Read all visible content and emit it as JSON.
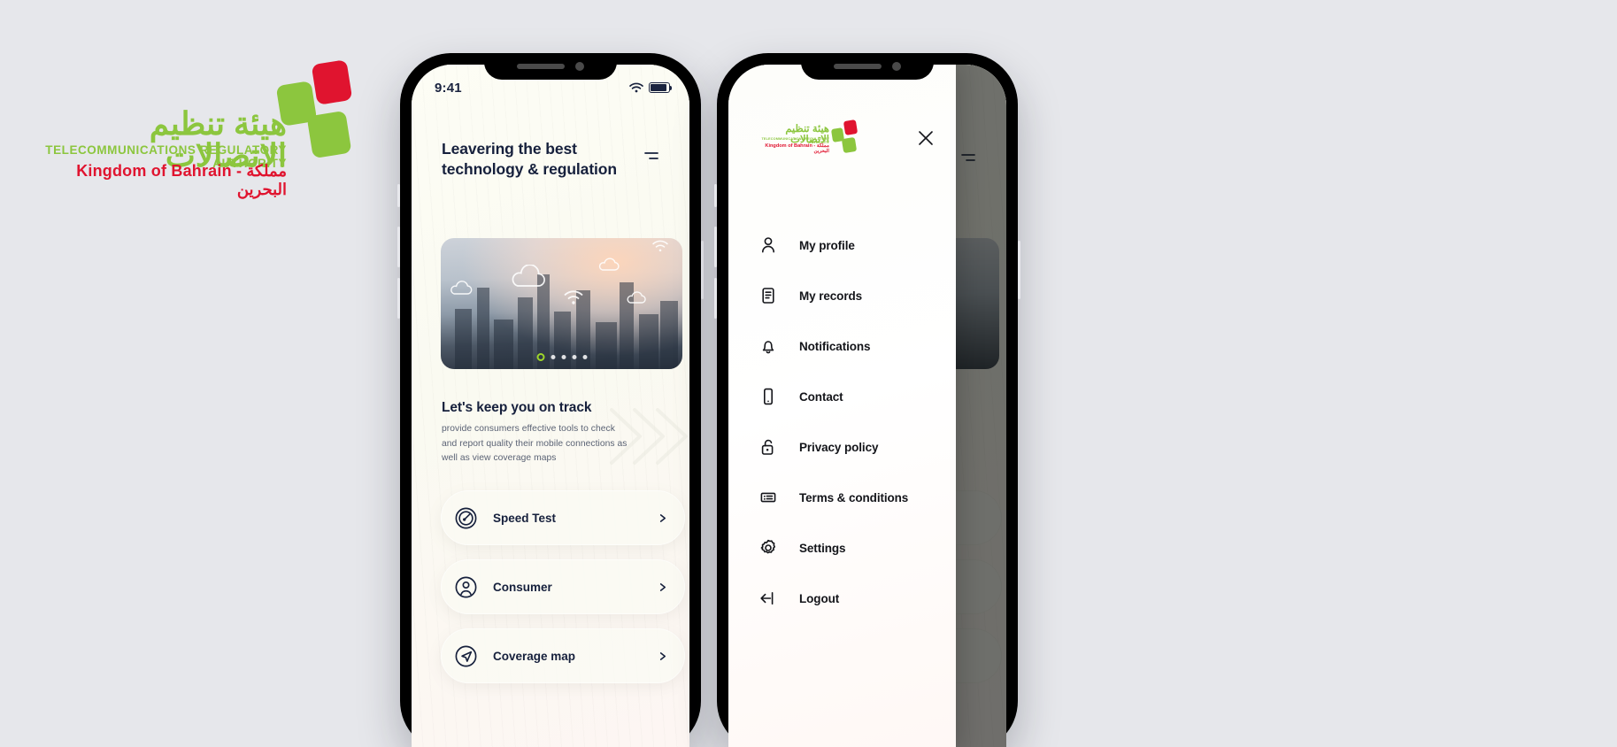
{
  "brand": {
    "arabic_name": "هيئة تنظيم الاتصالات",
    "english_name": "TELECOMMUNICATIONS REGULATORY AUTHORITY",
    "kingdom_line": "Kingdom of Bahrain - مملكة البحرين",
    "colors": {
      "green": "#8cc63e",
      "red": "#e0142f",
      "navy": "#16203c",
      "accent_dot": "#9ed62a"
    }
  },
  "phone1": {
    "status": {
      "time": "9:41",
      "wifi_icon": "wifi-icon",
      "battery_icon": "battery-icon"
    },
    "header": {
      "title": "Leavering the best technology & regulation",
      "menu_icon": "hamburger-menu-icon"
    },
    "hero": {
      "alt": "city skyline at dusk with cloud and wifi overlay icons",
      "dots_total": 5,
      "dots_active_index": 0
    },
    "section": {
      "title": "Let's keep you on track",
      "body": "provide consumers effective tools to check and report quality their mobile connections as well as view coverage maps"
    },
    "rows": [
      {
        "label": "Speed Test",
        "icon": "speedometer-icon",
        "chevron": "chevron-right-icon"
      },
      {
        "label": "Consumer",
        "icon": "user-circle-icon",
        "chevron": "chevron-right-icon"
      },
      {
        "label": "Coverage map",
        "icon": "navigation-arrow-circle-icon",
        "chevron": "chevron-right-icon"
      }
    ]
  },
  "phone2": {
    "drawer": {
      "close_icon": "close-icon",
      "logo": {
        "arabic_name": "هيئة تنظيم الاتصالات",
        "english_name": "TELECOMMUNICATIONS REGULATORY AUTHORITY",
        "kingdom_line": "Kingdom of Bahrain - مملكة البحرين"
      },
      "items": [
        {
          "label": "My profile",
          "icon": "user-icon"
        },
        {
          "label": "My records",
          "icon": "document-list-icon"
        },
        {
          "label": "Notifications",
          "icon": "bell-icon"
        },
        {
          "label": "Contact",
          "icon": "mobile-phone-icon"
        },
        {
          "label": "Privacy policy",
          "icon": "unlock-icon"
        },
        {
          "label": "Terms & conditions",
          "icon": "terms-list-icon"
        },
        {
          "label": "Settings",
          "icon": "gear-icon"
        },
        {
          "label": "Logout",
          "icon": "logout-arrow-icon"
        }
      ]
    }
  }
}
